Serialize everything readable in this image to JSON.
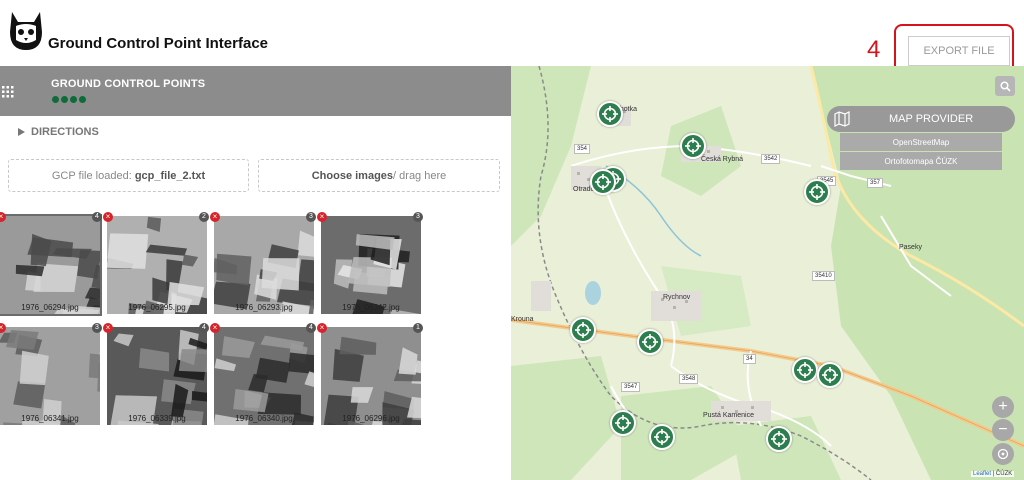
{
  "header": {
    "title": "Ground Control Point Interface",
    "step_annotation": "4",
    "export_label": "EXPORT FILE",
    "annotation_color": "#d4141a"
  },
  "panel": {
    "section_title": "GROUND CONTROL POINTS",
    "step_count": 4,
    "directions_label": "DIRECTIONS",
    "gcp_file_prefix": "GCP file loaded: ",
    "gcp_file_name": "gcp_file_2.txt",
    "choose_images_label": "Choose images",
    "choose_images_suffix": " / drag here",
    "accent_color": "#0e6b3a"
  },
  "images": [
    {
      "name": "1976_06294.jpg",
      "count": "4",
      "remove": "×"
    },
    {
      "name": "1976_06295.jpg",
      "count": "2",
      "remove": "×"
    },
    {
      "name": "1976_06293.jpg",
      "count": "3",
      "remove": "×"
    },
    {
      "name": "1976_06342.jpg",
      "count": "3",
      "remove": "×"
    },
    {
      "name": "1976_06341.jpg",
      "count": "3",
      "remove": "×"
    },
    {
      "name": "1976_06339.jpg",
      "count": "4",
      "remove": "×"
    },
    {
      "name": "1976_06340.jpg",
      "count": "4",
      "remove": "×"
    },
    {
      "name": "1976_06296.jpg",
      "count": "1",
      "remove": "×"
    }
  ],
  "map": {
    "provider_button": "MAP PROVIDER",
    "providers": [
      "OpenStreetMap",
      "Ortofotomapa ČÚZK"
    ],
    "zoom_in": "+",
    "zoom_out": "−",
    "attribution_link": "Leaflet",
    "attribution_text": " | ČÚZK",
    "place_labels": [
      "Otradov",
      "Česká Rybná",
      "Paseky",
      "Rychnov",
      "Krouna",
      "Pustá Kamenice",
      "Lhotka"
    ],
    "road_numbers": [
      "354",
      "3542",
      "3545",
      "357",
      "35410",
      "34",
      "3547",
      "3548"
    ],
    "marker_color": "#2e7d4f"
  }
}
